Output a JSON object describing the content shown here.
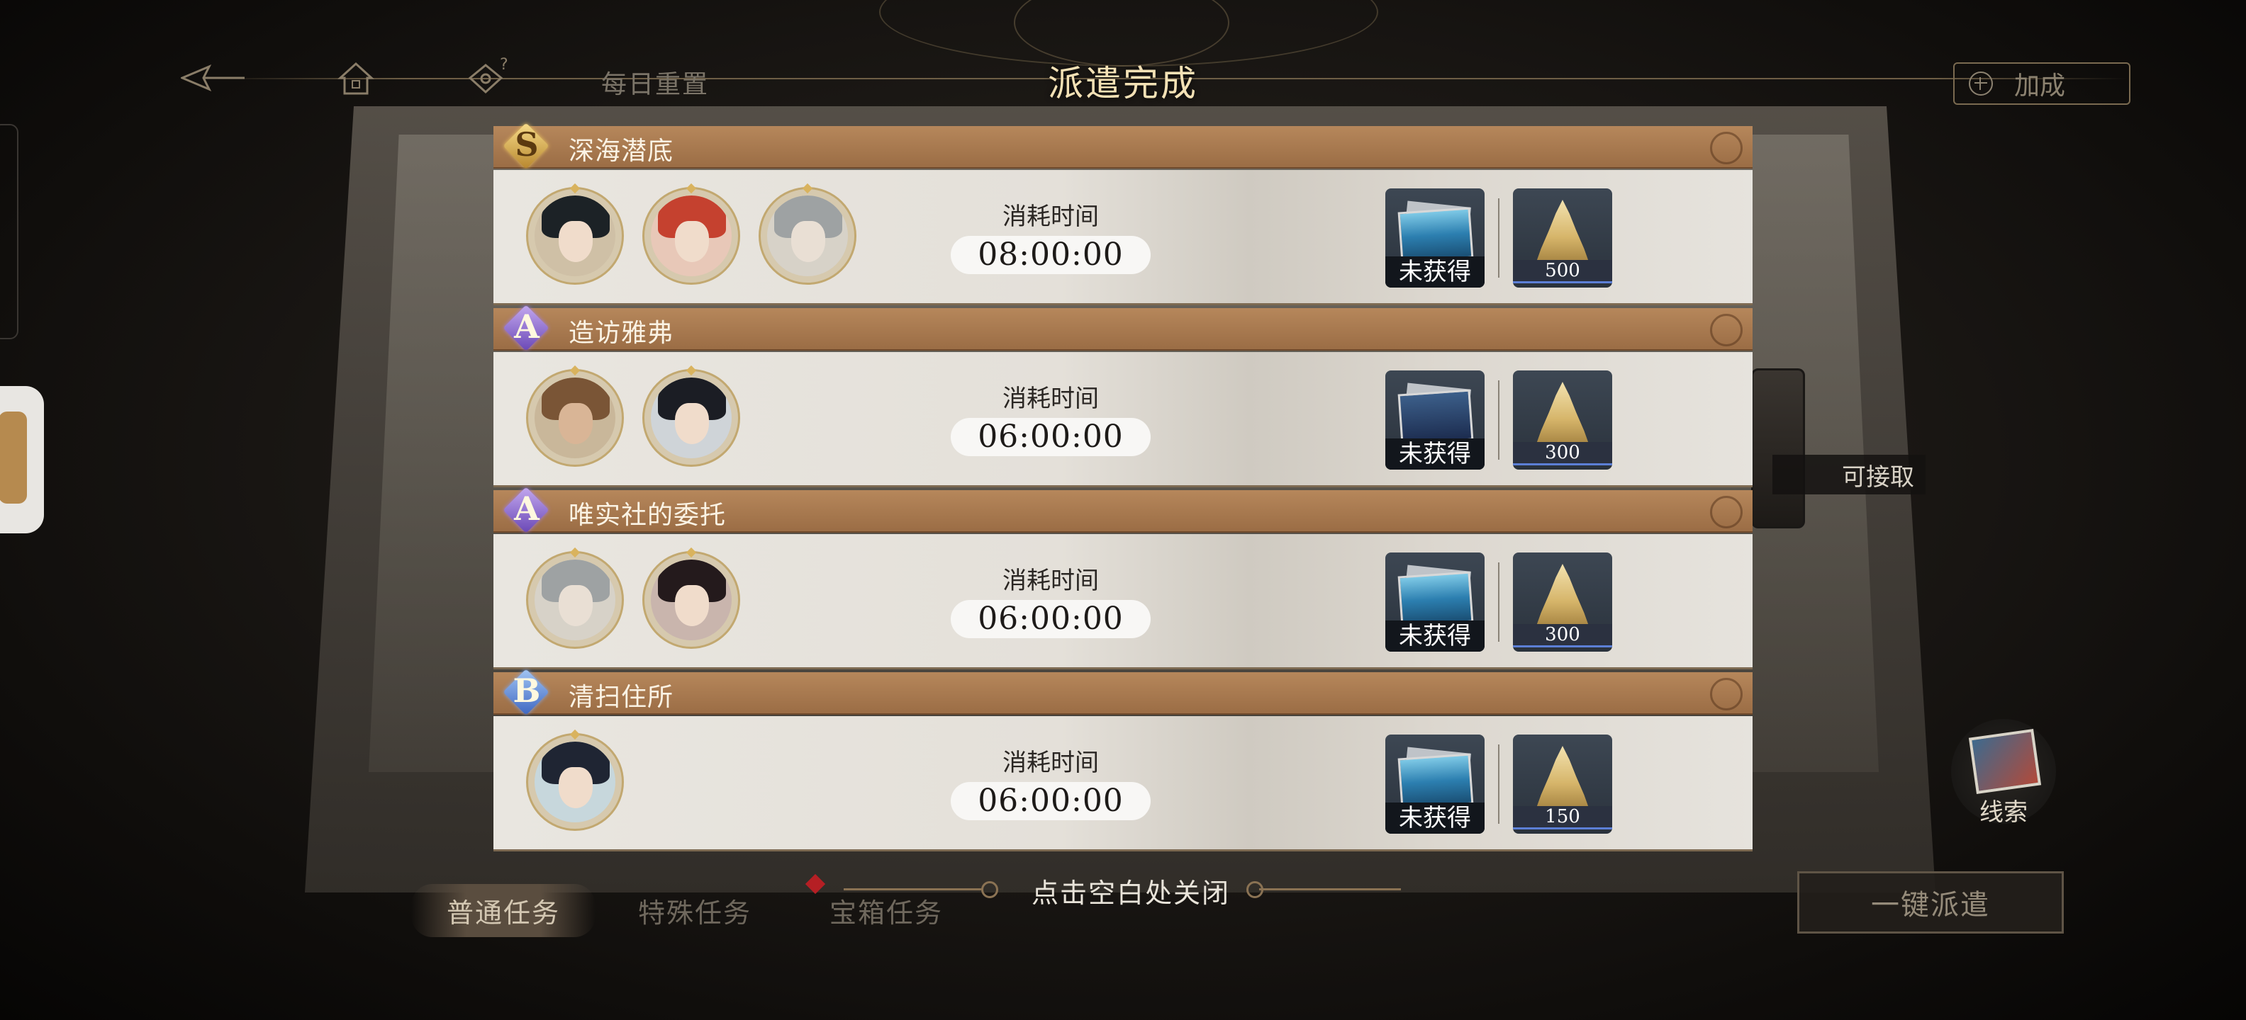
{
  "header": {
    "title": "派遣完成",
    "daily_reset": "每日重置",
    "boost_label": "加成"
  },
  "side": {
    "available_label": "可接取",
    "clue_label": "线索"
  },
  "missions": [
    {
      "rank": "S",
      "name": "深海潜底",
      "time_label": "消耗时间",
      "time_value": "08:00:00",
      "reward_photo_status": "未获得",
      "reward_gold_amount": "500"
    },
    {
      "rank": "A",
      "name": "造访雅弗",
      "time_label": "消耗时间",
      "time_value": "06:00:00",
      "reward_photo_status": "未获得",
      "reward_gold_amount": "300"
    },
    {
      "rank": "A",
      "name": "唯实社的委托",
      "time_label": "消耗时间",
      "time_value": "06:00:00",
      "reward_photo_status": "未获得",
      "reward_gold_amount": "300"
    },
    {
      "rank": "B",
      "name": "清扫住所",
      "time_label": "消耗时间",
      "time_value": "06:00:00",
      "reward_photo_status": "未获得",
      "reward_gold_amount": "150"
    }
  ],
  "bottom": {
    "tabs": [
      "普通任务",
      "特殊任务",
      "宝箱任务"
    ],
    "close_hint": "点击空白处关闭",
    "dispatch_all_label": "一键派遣"
  },
  "colors": {
    "header_bar": "#b6875b",
    "title_text": "#f3e1b5",
    "card_body": "#e9e6e0",
    "tab_notice": "#b51f24"
  }
}
